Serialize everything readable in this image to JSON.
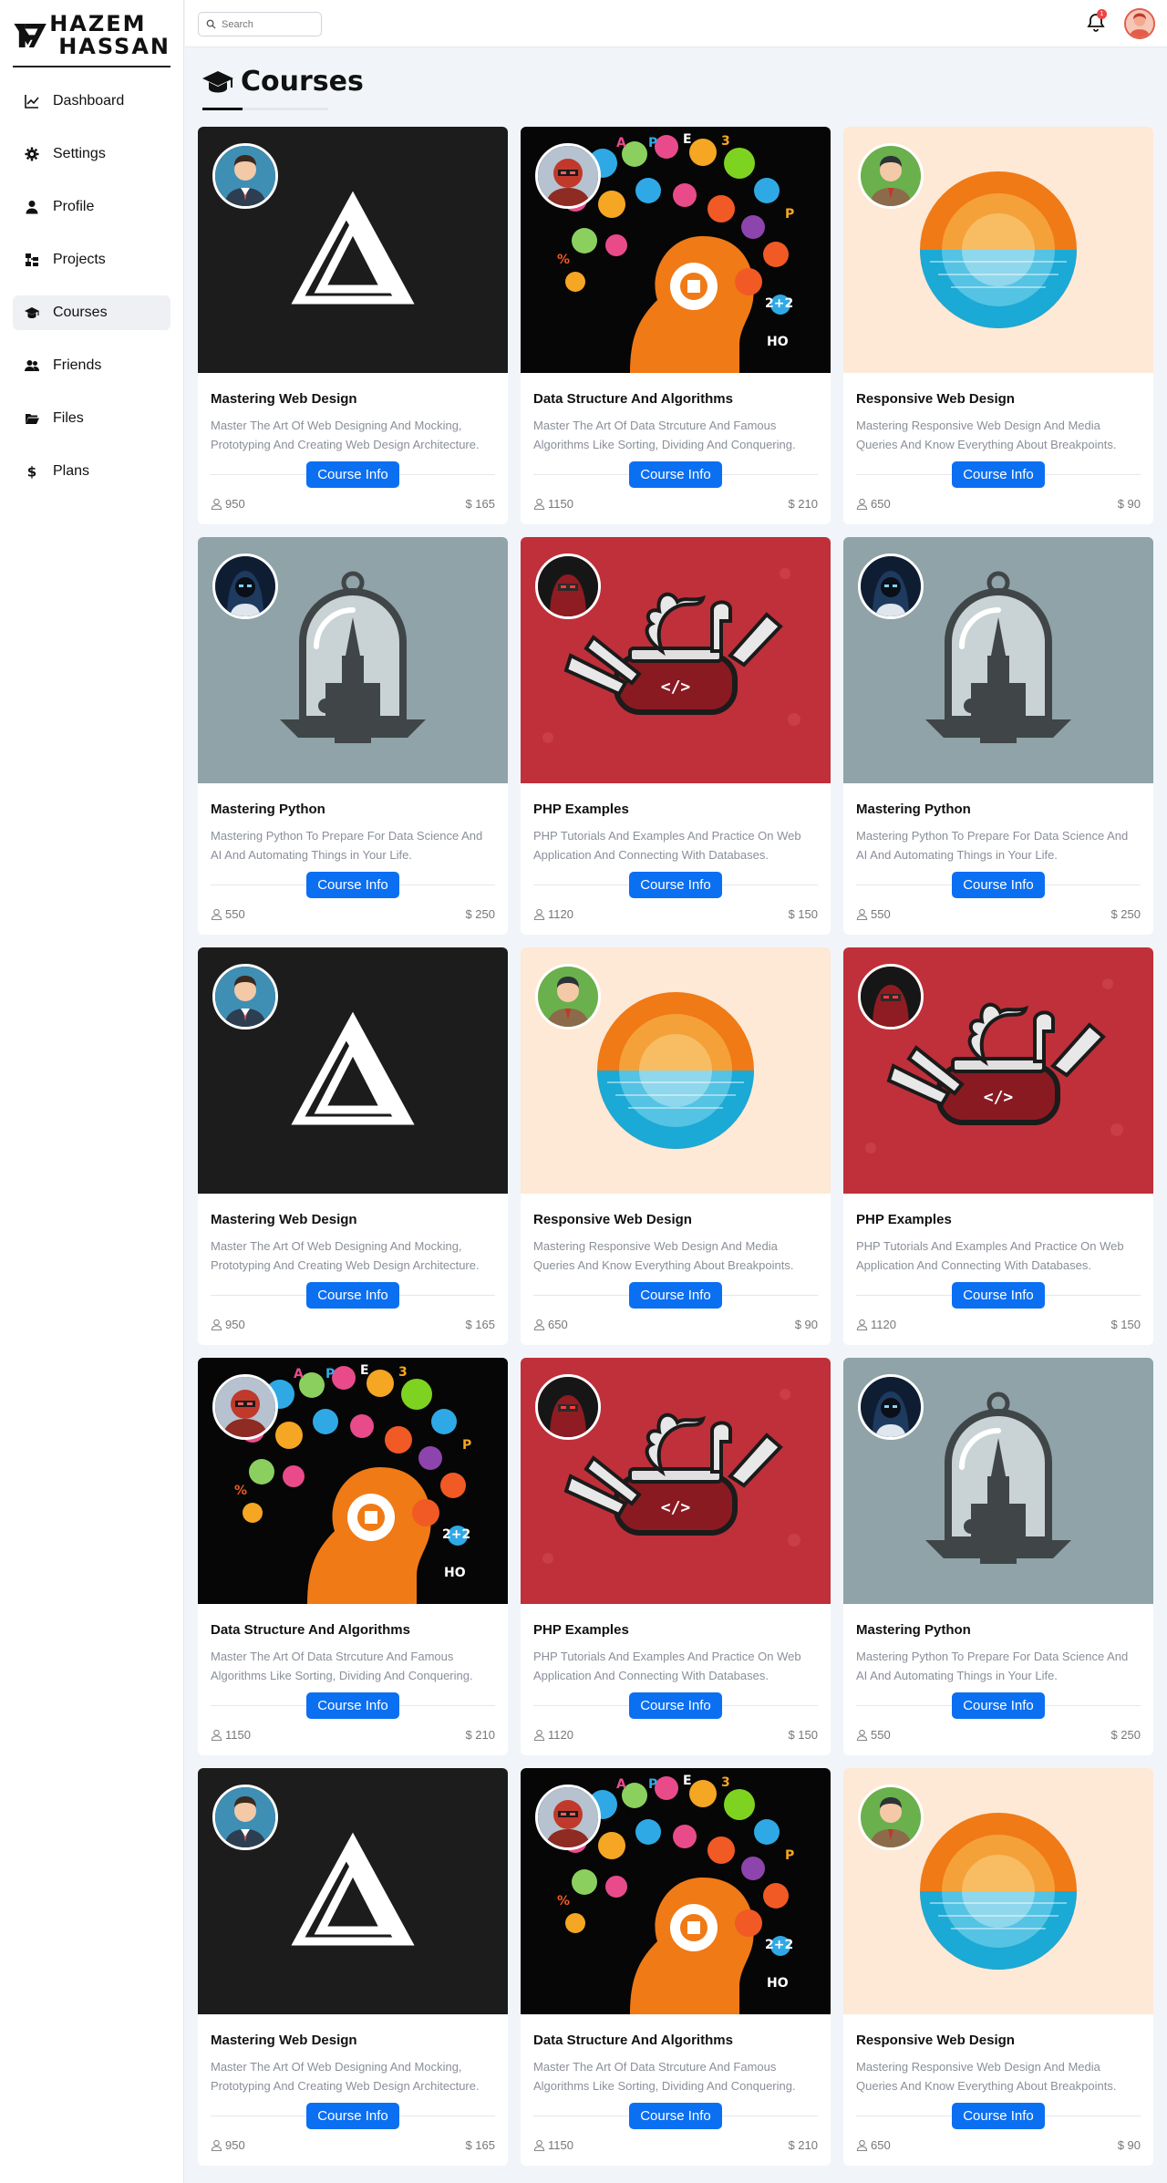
{
  "brand": {
    "line1": "HAZEM",
    "line2": "HASSAN"
  },
  "sidebar": {
    "items": [
      {
        "label": "Dashboard",
        "icon": "chart-line-icon",
        "active": false
      },
      {
        "label": "Settings",
        "icon": "gear-icon",
        "active": false
      },
      {
        "label": "Profile",
        "icon": "user-icon",
        "active": false
      },
      {
        "label": "Projects",
        "icon": "diagram-icon",
        "active": false
      },
      {
        "label": "Courses",
        "icon": "graduation-cap-icon",
        "active": true
      },
      {
        "label": "Friends",
        "icon": "users-icon",
        "active": false
      },
      {
        "label": "Files",
        "icon": "folder-open-icon",
        "active": false
      },
      {
        "label": "Plans",
        "icon": "dollar-icon",
        "active": false
      }
    ]
  },
  "header": {
    "search_placeholder": "Search",
    "notification_count": "1"
  },
  "page": {
    "title": "Courses"
  },
  "colors": {
    "accent": "#0b6ff2",
    "badge": "#ef4444"
  },
  "courses": [
    {
      "title": "Mastering Web Design",
      "desc": "Master The Art Of Web Designing And Mocking, Prototyping And Creating Web Design Architecture.",
      "button": "Course Info",
      "students": "950",
      "price": "$ 165",
      "art": "web",
      "avatar": "man-blue"
    },
    {
      "title": "Data Structure And Algorithms",
      "desc": "Master The Art Of Data Strcuture And Famous Algorithms Like Sorting, Dividing And Conquering.",
      "button": "Course Info",
      "students": "1150",
      "price": "$ 210",
      "art": "ds",
      "avatar": "robot-red"
    },
    {
      "title": "Responsive Web Design",
      "desc": "Mastering Responsive Web Design And Media Queries And Know Everything About Breakpoints.",
      "button": "Course Info",
      "students": "650",
      "price": "$ 90",
      "art": "resp",
      "avatar": "man-green"
    },
    {
      "title": "Mastering Python",
      "desc": "Mastering Python To Prepare For Data Science And AI And Automating Things in Your Life.",
      "button": "Course Info",
      "students": "550",
      "price": "$ 250",
      "art": "py",
      "avatar": "hood-dark"
    },
    {
      "title": "PHP Examples",
      "desc": "PHP Tutorials And Examples And Practice On Web Application And Connecting With Databases.",
      "button": "Course Info",
      "students": "1120",
      "price": "$ 150",
      "art": "php",
      "avatar": "ninja-red"
    },
    {
      "title": "Mastering Python",
      "desc": "Mastering Python To Prepare For Data Science And AI And Automating Things in Your Life.",
      "button": "Course Info",
      "students": "550",
      "price": "$ 250",
      "art": "py",
      "avatar": "hood-dark"
    },
    {
      "title": "Mastering Web Design",
      "desc": "Master The Art Of Web Designing And Mocking, Prototyping And Creating Web Design Architecture.",
      "button": "Course Info",
      "students": "950",
      "price": "$ 165",
      "art": "web",
      "avatar": "man-blue"
    },
    {
      "title": "Responsive Web Design",
      "desc": "Mastering Responsive Web Design And Media Queries And Know Everything About Breakpoints.",
      "button": "Course Info",
      "students": "650",
      "price": "$ 90",
      "art": "resp",
      "avatar": "man-green"
    },
    {
      "title": "PHP Examples",
      "desc": "PHP Tutorials And Examples And Practice On Web Application And Connecting With Databases.",
      "button": "Course Info",
      "students": "1120",
      "price": "$ 150",
      "art": "php",
      "avatar": "ninja-red"
    },
    {
      "title": "Data Structure And Algorithms",
      "desc": "Master The Art Of Data Strcuture And Famous Algorithms Like Sorting, Dividing And Conquering.",
      "button": "Course Info",
      "students": "1150",
      "price": "$ 210",
      "art": "ds",
      "avatar": "robot-red"
    },
    {
      "title": "PHP Examples",
      "desc": "PHP Tutorials And Examples And Practice On Web Application And Connecting With Databases.",
      "button": "Course Info",
      "students": "1120",
      "price": "$ 150",
      "art": "php",
      "avatar": "ninja-red"
    },
    {
      "title": "Mastering Python",
      "desc": "Mastering Python To Prepare For Data Science And AI And Automating Things in Your Life.",
      "button": "Course Info",
      "students": "550",
      "price": "$ 250",
      "art": "py",
      "avatar": "hood-dark"
    },
    {
      "title": "Mastering Web Design",
      "desc": "Master The Art Of Web Designing And Mocking, Prototyping And Creating Web Design Architecture.",
      "button": "Course Info",
      "students": "950",
      "price": "$ 165",
      "art": "web",
      "avatar": "man-blue"
    },
    {
      "title": "Data Structure And Algorithms",
      "desc": "Master The Art Of Data Strcuture And Famous Algorithms Like Sorting, Dividing And Conquering.",
      "button": "Course Info",
      "students": "1150",
      "price": "$ 210",
      "art": "ds",
      "avatar": "robot-red"
    },
    {
      "title": "Responsive Web Design",
      "desc": "Mastering Responsive Web Design And Media Queries And Know Everything About Breakpoints.",
      "button": "Course Info",
      "students": "650",
      "price": "$ 90",
      "art": "resp",
      "avatar": "man-green"
    }
  ]
}
